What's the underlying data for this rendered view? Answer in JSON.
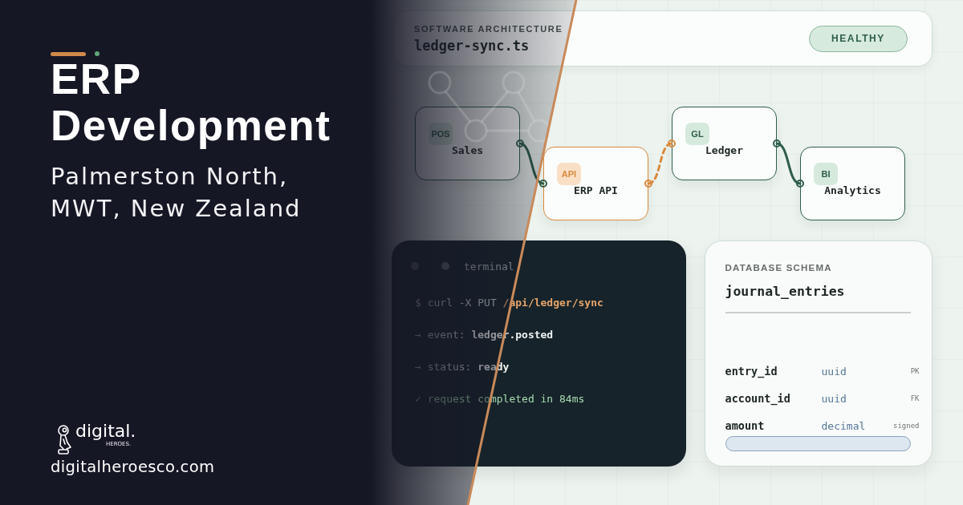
{
  "intro": {
    "title": "ERP Development",
    "subtitle": "Palmerston North, MWT, New Zealand"
  },
  "brand": {
    "wordmark": "digital.",
    "tagline": "HEROES.",
    "url": "digitalheroesco.com"
  },
  "header": {
    "eyebrow": "SOFTWARE ARCHITECTURE",
    "filename": "ledger-sync.ts",
    "status": "HEALTHY"
  },
  "diagram": {
    "nodes": [
      {
        "badge": "POS",
        "label": "Sales",
        "accent": false
      },
      {
        "badge": "API",
        "label": "ERP API",
        "accent": true
      },
      {
        "badge": "GL",
        "label": "Ledger",
        "accent": false
      },
      {
        "badge": "BI",
        "label": "Analytics",
        "accent": false
      }
    ],
    "edges": [
      {
        "kind": "solid",
        "accent": false
      },
      {
        "kind": "dashed",
        "accent": true
      },
      {
        "kind": "solid",
        "accent": false
      }
    ]
  },
  "terminal": {
    "title": "terminal",
    "lines": [
      {
        "kind": "command",
        "prefix": "$ curl -X PUT",
        "value": "/api/ledger/sync"
      },
      {
        "kind": "output",
        "prefix": "→ event:",
        "value": "ledger.posted"
      },
      {
        "kind": "output",
        "prefix": "→ status:",
        "value": "ready"
      },
      {
        "kind": "success",
        "prefix": "✓",
        "value": "request completed in 84ms"
      }
    ]
  },
  "schema": {
    "eyebrow": "DATABASE SCHEMA",
    "table": "journal_entries",
    "columns": [
      {
        "name": "entry_id",
        "type": "uuid",
        "flag": "PK"
      },
      {
        "name": "account_id",
        "type": "uuid",
        "flag": "FK"
      },
      {
        "name": "amount",
        "type": "decimal",
        "flag": "signed"
      }
    ]
  }
}
